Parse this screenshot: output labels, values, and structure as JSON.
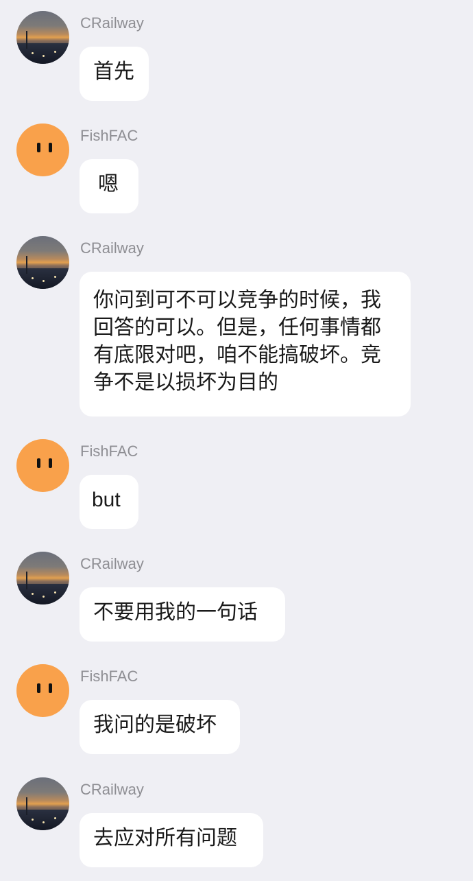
{
  "messages": [
    {
      "sender": "CRailway",
      "avatar": "sunset-photo-avatar",
      "text": "首先"
    },
    {
      "sender": "FishFAC",
      "avatar": "orange-face-avatar",
      "text": "嗯"
    },
    {
      "sender": "CRailway",
      "avatar": "sunset-photo-avatar",
      "text": "你问到可不可以竞争的时候，我回答的可以。但是，任何事情都有底限对吧，咱不能搞破坏。竞争不是以损坏为目的"
    },
    {
      "sender": "FishFAC",
      "avatar": "orange-face-avatar",
      "text": "but"
    },
    {
      "sender": "CRailway",
      "avatar": "sunset-photo-avatar",
      "text": "不要用我的一句话"
    },
    {
      "sender": "FishFAC",
      "avatar": "orange-face-avatar",
      "text": "我问的是破坏"
    },
    {
      "sender": "CRailway",
      "avatar": "sunset-photo-avatar",
      "text": "去应对所有问题"
    }
  ],
  "colors": {
    "background": "#EFEFF4",
    "bubble": "#FFFFFF",
    "name": "#8E8E93",
    "fishfac_avatar": "#F9A14B"
  }
}
